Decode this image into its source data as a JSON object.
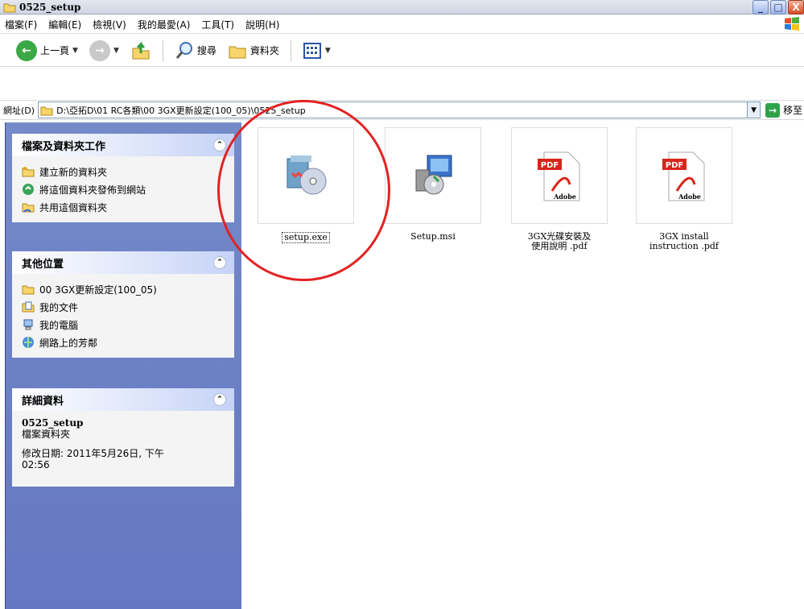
{
  "window": {
    "title": "0525_setup",
    "buttons": [
      "_",
      "□",
      "X"
    ]
  },
  "menu": [
    "檔案(F)",
    "編輯(E)",
    "檢視(V)",
    "我的最愛(A)",
    "工具(T)",
    "說明(H)"
  ],
  "toolbar": {
    "back": "上一頁",
    "search": "搜尋",
    "folders": "資料夾"
  },
  "address": {
    "label": "網址(D)",
    "path": "D:\\亞拓D\\01 RC各類\\00 3GX更新設定(100_05)\\0525_setup",
    "go": "移至"
  },
  "tasks_panel": {
    "title": "檔案及資料夾工作",
    "items": [
      "建立新的資料夾",
      "將這個資料夾發佈到網站",
      "共用這個資料夾"
    ]
  },
  "places_panel": {
    "title": "其他位置",
    "items": [
      "00 3GX更新設定(100_05)",
      "我的文件",
      "我的電腦",
      "網路上的芳鄰"
    ]
  },
  "details_panel": {
    "title": "詳細資料",
    "name": "0525_setup",
    "type": "檔案資料夾",
    "modified_1": "修改日期: 2011年5月26日, 下午",
    "modified_2": "02:56"
  },
  "files": [
    {
      "name_1": "setup.exe",
      "name_2": ""
    },
    {
      "name_1": "Setup.msi",
      "name_2": ""
    },
    {
      "name_1": "3GX光碟安裝及",
      "name_2": "使用說明 .pdf"
    },
    {
      "name_1": "3GX install",
      "name_2": "instruction .pdf"
    }
  ],
  "pdf_badge": "PDF",
  "adobe_label": "Adobe",
  "colors": {
    "highlight_circle": "#e32222",
    "panel_bg": "#6f83c6"
  }
}
